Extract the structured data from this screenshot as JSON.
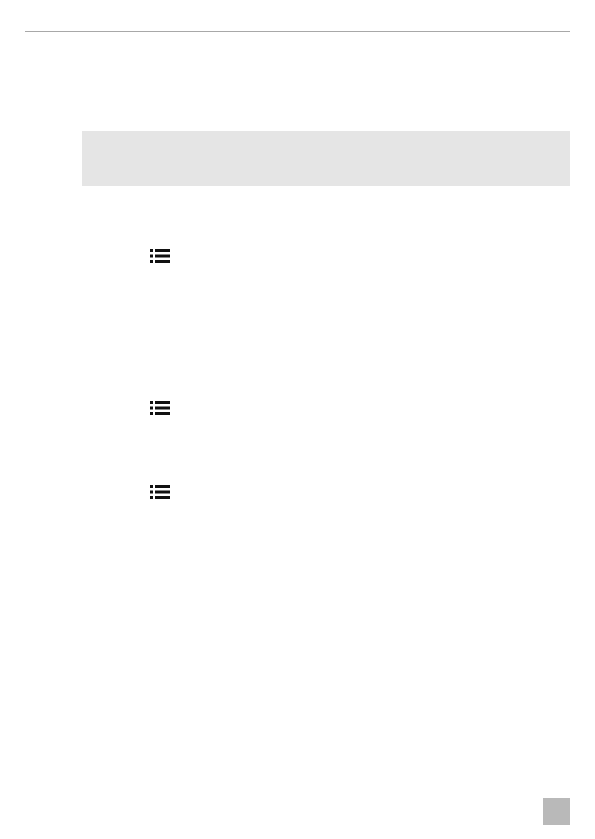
{
  "page": {
    "colors": {
      "rule": "#a8a8a8",
      "shaded_box": "#e5e5e5",
      "page_tab": "#b9b9b9",
      "icon": "#111111"
    },
    "icons": [
      {
        "name": "list-icon"
      },
      {
        "name": "list-icon"
      },
      {
        "name": "list-icon"
      }
    ]
  }
}
